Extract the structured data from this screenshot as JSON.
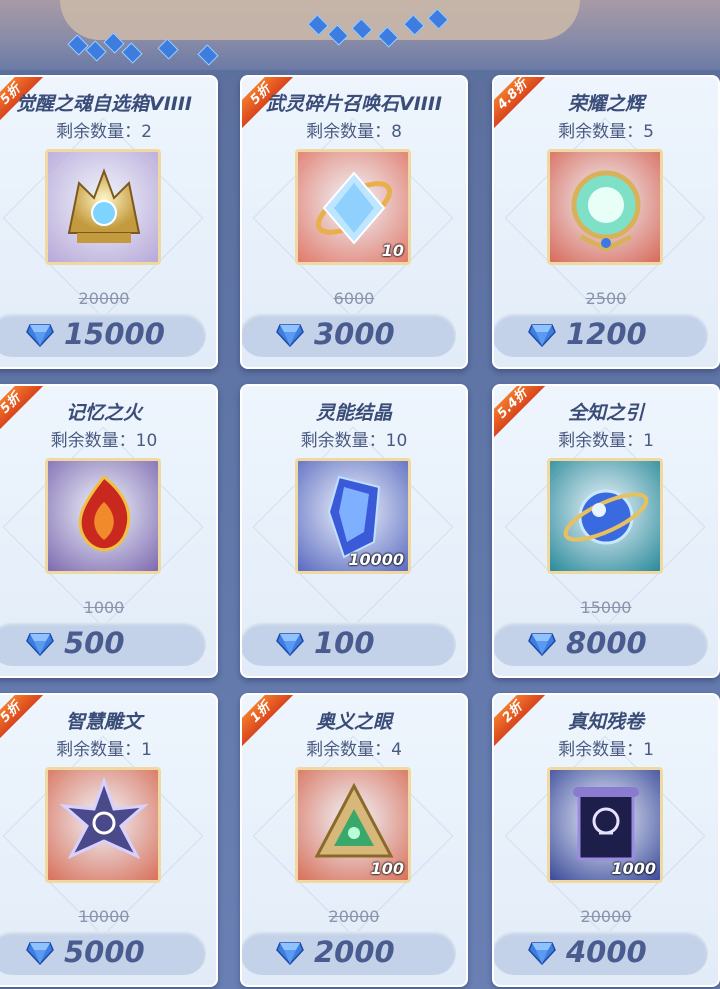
{
  "colors": {
    "card_bg": "#eef5fd",
    "ribbon": "#e85a22",
    "title_text": "#3a4c78",
    "price_text": "#4a5c8f",
    "diamond": "#3e7de0"
  },
  "items": [
    {
      "discount": "5折",
      "title": "觉醒之魂自选箱VIIII",
      "remaining": "剩余数量：2",
      "quantity": "",
      "original_price": "20000",
      "price": "15000",
      "icon": "awakening-soul-chest-icon",
      "bg": "#b8a8d8"
    },
    {
      "discount": "5折",
      "title": "武灵碎片召唤石VIIII",
      "remaining": "剩余数量：8",
      "quantity": "10",
      "original_price": "6000",
      "price": "3000",
      "icon": "summon-crystal-icon",
      "bg": "#e07a6a"
    },
    {
      "discount": "4.8折",
      "title": "荣耀之辉",
      "remaining": "剩余数量：5",
      "quantity": "",
      "original_price": "2500",
      "price": "1200",
      "icon": "glory-orb-icon",
      "bg": "#d86a5a"
    },
    {
      "discount": "5折",
      "title": "记忆之火",
      "remaining": "剩余数量：10",
      "quantity": "",
      "original_price": "1000",
      "price": "500",
      "icon": "memory-flame-icon",
      "bg": "#7e6ab0"
    },
    {
      "discount": "",
      "title": "灵能结晶",
      "remaining": "剩余数量：10",
      "quantity": "10000",
      "original_price": "",
      "price": "100",
      "icon": "psionic-crystal-icon",
      "bg": "#5a6ac0"
    },
    {
      "discount": "5.4折",
      "title": "全知之引",
      "remaining": "剩余数量：1",
      "quantity": "",
      "original_price": "15000",
      "price": "8000",
      "icon": "omniscience-orb-icon",
      "bg": "#2a8a9a"
    },
    {
      "discount": "5折",
      "title": "智慧雕文",
      "remaining": "剩余数量：1",
      "quantity": "",
      "original_price": "10000",
      "price": "5000",
      "icon": "wisdom-glyph-icon",
      "bg": "#d8705a"
    },
    {
      "discount": "1折",
      "title": "奥义之眼",
      "remaining": "剩余数量：4",
      "quantity": "100",
      "original_price": "20000",
      "price": "2000",
      "icon": "arcane-eye-icon",
      "bg": "#d8705a"
    },
    {
      "discount": "2折",
      "title": "真知残卷",
      "remaining": "剩余数量：1",
      "quantity": "1000",
      "original_price": "20000",
      "price": "4000",
      "icon": "truth-scroll-icon",
      "bg": "#3a4a9a"
    }
  ]
}
